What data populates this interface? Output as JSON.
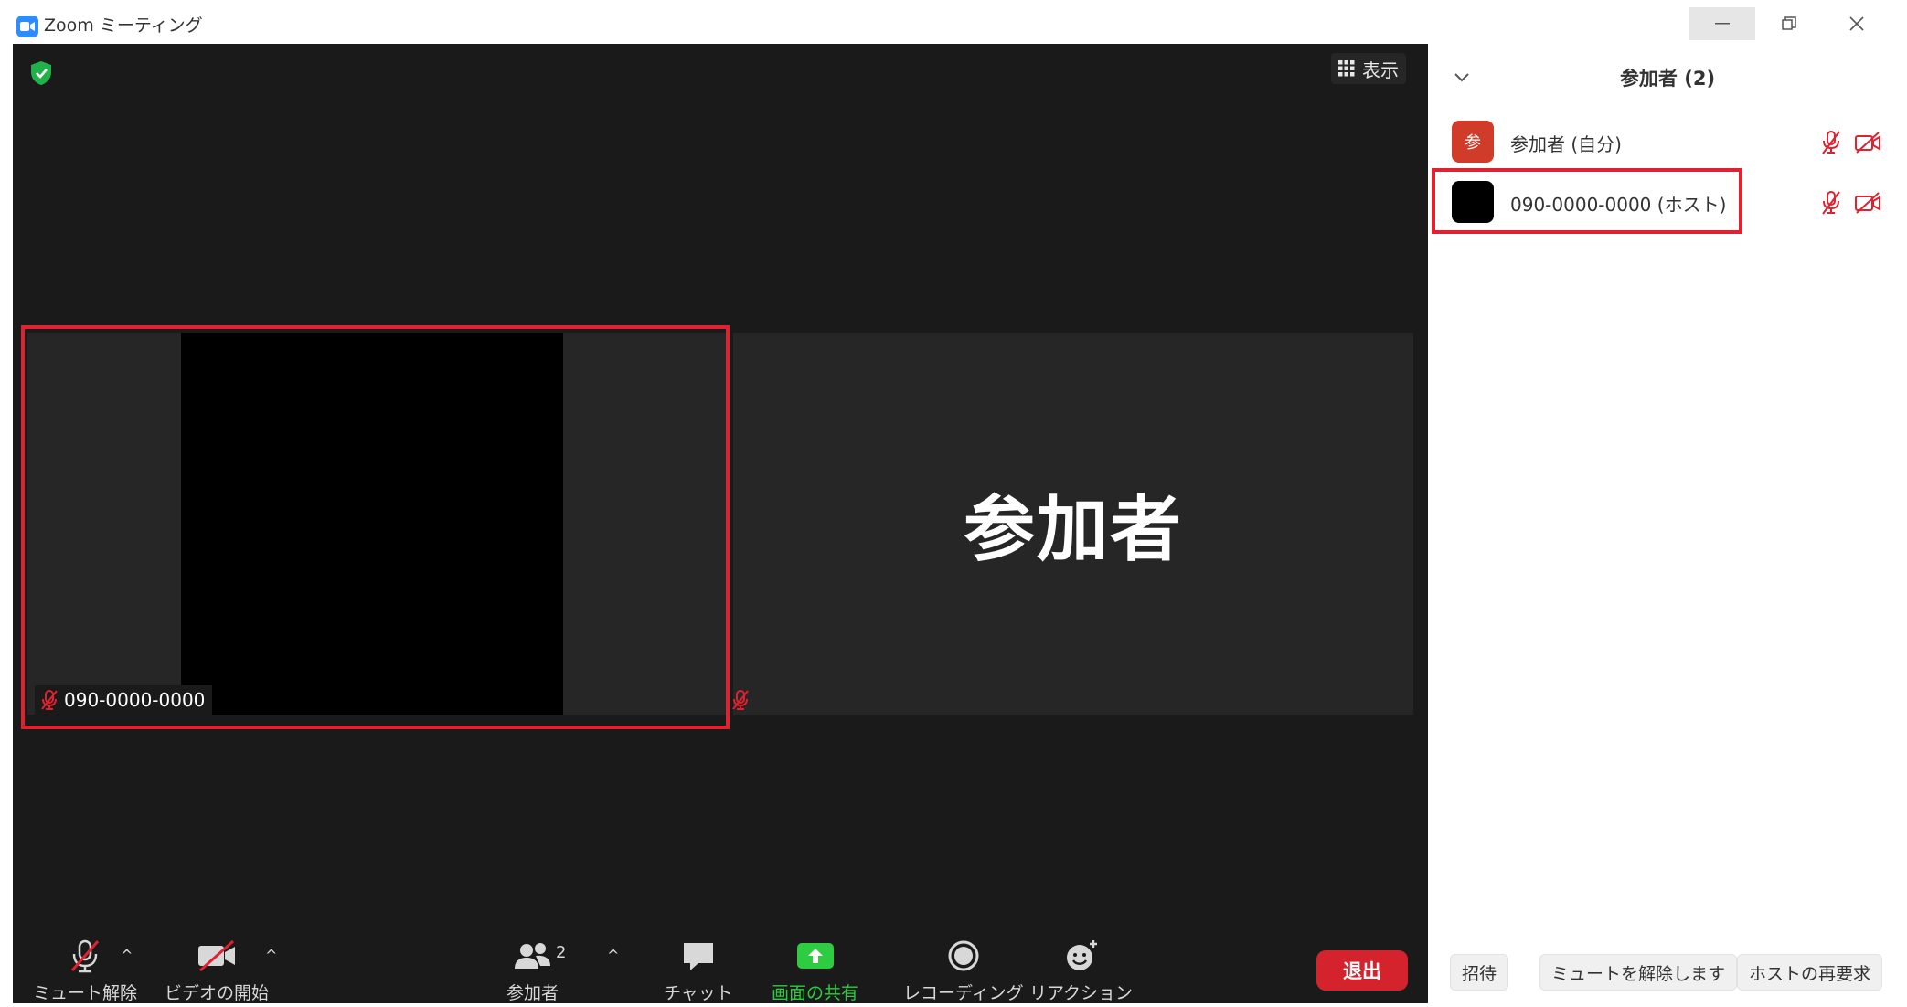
{
  "window": {
    "title": "Zoom ミーティング"
  },
  "meeting": {
    "view_label": "表示",
    "left_tile": {
      "name": "090-0000-0000"
    },
    "right_tile": {
      "name": "参加者"
    }
  },
  "toolbar": {
    "unmute_label": "ミュート解除",
    "start_video_label": "ビデオの開始",
    "participants_label": "参加者",
    "participants_count": "2",
    "chat_label": "チャット",
    "share_label": "画面の共有",
    "record_label": "レコーディング",
    "reactions_label": "リアクション",
    "leave_label": "退出"
  },
  "panel": {
    "title": "参加者 (2)",
    "participants": [
      {
        "avatar_text": "参",
        "avatar_color": "#d03b2a",
        "name": "参加者 (自分)"
      },
      {
        "avatar_text": "",
        "avatar_color": "#000000",
        "name": "090-0000-0000 (ホスト)"
      }
    ],
    "invite_label": "招待",
    "unmute_all_label": "ミュートを解除します",
    "reclaim_host_label": "ホストの再要求"
  },
  "colors": {
    "meeting_bg": "#1a1a1a",
    "tile_bg": "#262626",
    "highlight": "#e0212f",
    "share_green": "#2ecc40",
    "leave_red": "#d4232d",
    "muted_red": "#e0212f"
  }
}
